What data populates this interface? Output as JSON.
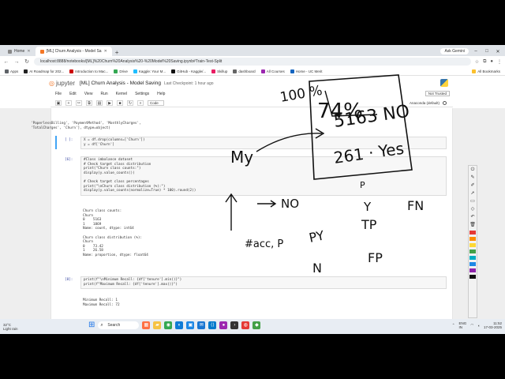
{
  "browser": {
    "tabs": [
      {
        "label": "Home",
        "active": false
      },
      {
        "label": "[ML] Churn Analysis - Model Sa",
        "active": true
      }
    ],
    "ask_gemini": "Ask Gemini",
    "url": "localhost:8888/notebooks/[ML]%20Churn%20Analysis%20-%20Model%20Saving.ipynb#Train-Test-Split",
    "bookmarks": [
      "Apps",
      "AI Roadmap for 202...",
      "Introduction to Mac...",
      "Drive",
      "Kaggle: Your M...",
      "GitHub - Kaggle/...",
      "Skillup",
      "dashboard",
      "All Courses",
      "Home - UC Merit",
      "All Bookmarks"
    ]
  },
  "jupyter": {
    "brand": "jupyter",
    "title": "[ML] Churn Analysis - Model Saving",
    "saved": "Last Checkpoint: 1 hour ago",
    "menu": [
      "File",
      "Edit",
      "View",
      "Run",
      "Kernel",
      "Settings",
      "Help"
    ],
    "trusted": "Not Trusted",
    "cell_type": "Code",
    "kernel": "Anaconda (default)"
  },
  "cells": {
    "c0_out": "'PaperlessBilling', 'PaymentMethod', 'MonthlyCharges',\n'TotalCharges', 'Churn'], dtype=object)",
    "c1_prompt": "[ ]:",
    "c1_code": "X = df.drop(columns=['Churn'])\ny = df['Churn']",
    "c2_prompt": "[6]:",
    "c2_code": "#Class imbalance dataset\n# Check target class distribution\nprint(\"Churn class counts:\")\ndisplay(y.value_counts())\n\n# Check target class percentages\nprint(\"\\nChurn class distribution (%):\")\ndisplay(y.value_counts(normalize=True) * 100).round(2))",
    "c2_out": "Churn class counts:\nChurn\n0    5163\n1    1869\nName: count, dtype: int64\n\nChurn class distribution (%):\nChurn\n0    73.42\n1    26.58\nName: proportion, dtype: float64",
    "c3_prompt": "[8]:",
    "c3_code": "print(f\"\\nMinimum Recall: {df['tenure'].min()}\")\nprint(f\"Maximum Recall: {df['tenure'].max()}\")",
    "c3_out": "Minimum Recall: 1\nMaximum Recall: 72"
  },
  "annotations": {
    "percent": "100 %",
    "top_value": "74%",
    "no_label": "5163 NO",
    "yes_value": "261 · Yes",
    "my_label": "My",
    "arrow_label": "NO",
    "p_label": "P",
    "y_label": "Y",
    "fn_label": "FN",
    "tp_label": "TP",
    "fp_label": "FP",
    "py_label": "PY",
    "n_label": "N",
    "acc_label": "#acc, P"
  },
  "taskbar": {
    "weather_temp": "32°C",
    "weather_desc": "Light rain",
    "search": "Search",
    "lang": "ENG\nIN",
    "time": "11:52",
    "date": "17-03-2025"
  },
  "colors": {
    "jupyter_orange": "#f37626",
    "prompt_blue": "#303f9f"
  }
}
